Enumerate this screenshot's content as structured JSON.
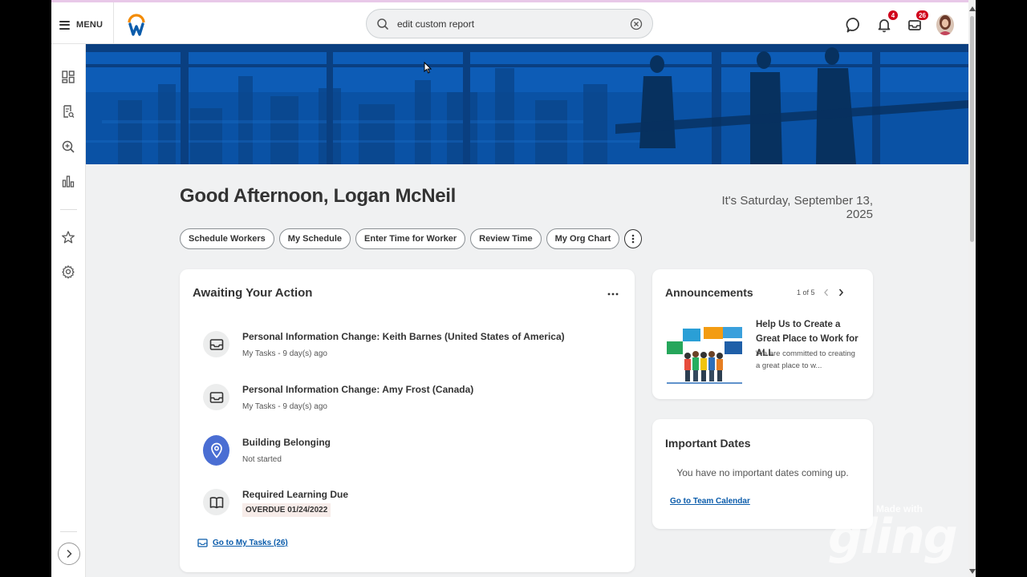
{
  "topbar": {
    "menu_label": "MENU",
    "search_value": "edit custom report",
    "notifications_count": "4",
    "inbox_count": "26"
  },
  "greeting": "Good Afternoon, Logan McNeil",
  "date_text": "It's Saturday, September 13, 2025",
  "quick_actions": [
    "Schedule Workers",
    "My Schedule",
    "Enter Time for Worker",
    "Review Time",
    "My Org Chart"
  ],
  "awaiting": {
    "title": "Awaiting Your Action",
    "tasks": [
      {
        "title": "Personal Information Change: Keith Barnes (United States of America)",
        "sub": "My Tasks - 9 day(s) ago",
        "icon": "inbox-icon"
      },
      {
        "title": "Personal Information Change: Amy Frost (Canada)",
        "sub": "My Tasks - 9 day(s) ago",
        "icon": "inbox-icon"
      },
      {
        "title": "Building Belonging",
        "sub": "Not started",
        "icon": "location-pin-icon"
      },
      {
        "title": "Required Learning Due",
        "sub": "OVERDUE 01/24/2022",
        "icon": "book-icon"
      }
    ],
    "link": "Go to My Tasks (26)"
  },
  "announcements": {
    "title": "Announcements",
    "pager": "1 of 5",
    "item_title": "Help Us to Create a Great Place to Work for ALL",
    "item_body": "We are committed to creating a great place to w..."
  },
  "important_dates": {
    "title": "Important Dates",
    "empty": "You have no important dates coming up.",
    "link": "Go to Team Calendar"
  },
  "watermark": {
    "made_with": "Made with",
    "logo": "gling"
  },
  "colors": {
    "banner": "#0d5cb6",
    "link": "#0b5cab",
    "badge": "#d0021b",
    "accent_pin": "#4a6ed3"
  }
}
